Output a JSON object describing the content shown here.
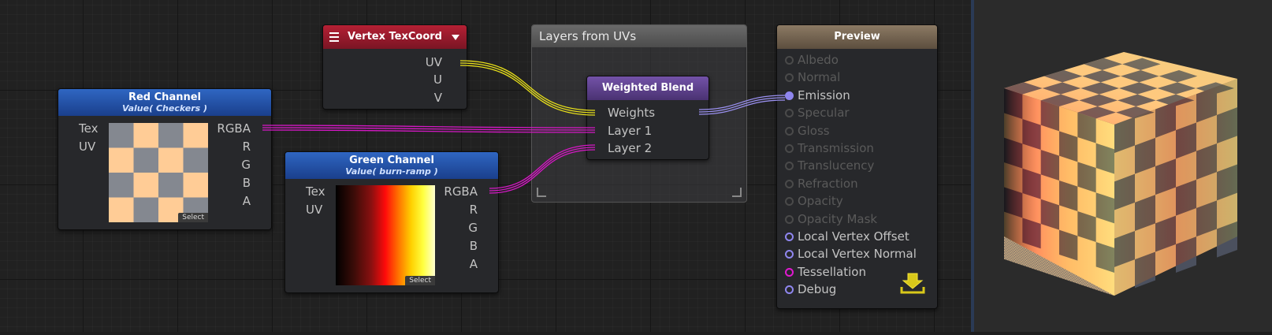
{
  "colors": {
    "port_yellow": "#f0ec18",
    "port_magenta": "#f015d8",
    "port_violet": "#8f86ee",
    "port_orange": "#e07a18",
    "header_blue": "#1f4fa6",
    "header_red": "#8e1b2a",
    "header_purple": "#5a3d8a",
    "header_tan": "#7c6a55"
  },
  "vertex_node": {
    "title": "Vertex TexCoord",
    "menu_icon": "hamburger-menu-icon",
    "dropdown_icon": "triangle-down-icon",
    "outputs": [
      "UV",
      "U",
      "V"
    ]
  },
  "red_node": {
    "title": "Red Channel",
    "subtitle": "Value( Checkers )",
    "inputs": [
      "Tex",
      "UV"
    ],
    "outputs": [
      "RGBA",
      "R",
      "G",
      "B",
      "A"
    ],
    "select_label": "Select",
    "thumbnail": "checker-texture"
  },
  "green_node": {
    "title": "Green Channel",
    "subtitle": "Value( burn-ramp )",
    "inputs": [
      "Tex",
      "UV"
    ],
    "outputs": [
      "RGBA",
      "R",
      "G",
      "B",
      "A"
    ],
    "select_label": "Select",
    "thumbnail": "burn-ramp-gradient"
  },
  "group": {
    "title": "Layers from UVs"
  },
  "blend_node": {
    "title": "Weighted Blend",
    "inputs": [
      "Weights",
      "Layer 1",
      "Layer 2"
    ]
  },
  "preview_node": {
    "title": "Preview",
    "inputs": [
      {
        "label": "Albedo",
        "active": false
      },
      {
        "label": "Normal",
        "active": false
      },
      {
        "label": "Emission",
        "active": true
      },
      {
        "label": "Specular",
        "active": false
      },
      {
        "label": "Gloss",
        "active": false
      },
      {
        "label": "Transmission",
        "active": false
      },
      {
        "label": "Translucency",
        "active": false
      },
      {
        "label": "Refraction",
        "active": false
      },
      {
        "label": "Opacity",
        "active": false
      },
      {
        "label": "Opacity Mask",
        "active": false
      },
      {
        "label": "Local Vertex Offset",
        "active": true
      },
      {
        "label": "Local Vertex Normal",
        "active": true
      },
      {
        "label": "Tessellation",
        "active": true
      },
      {
        "label": "Debug",
        "active": true
      }
    ],
    "export_icon": "download-tray-icon"
  },
  "preview_panel": {
    "object": "checker-cube-preview"
  }
}
